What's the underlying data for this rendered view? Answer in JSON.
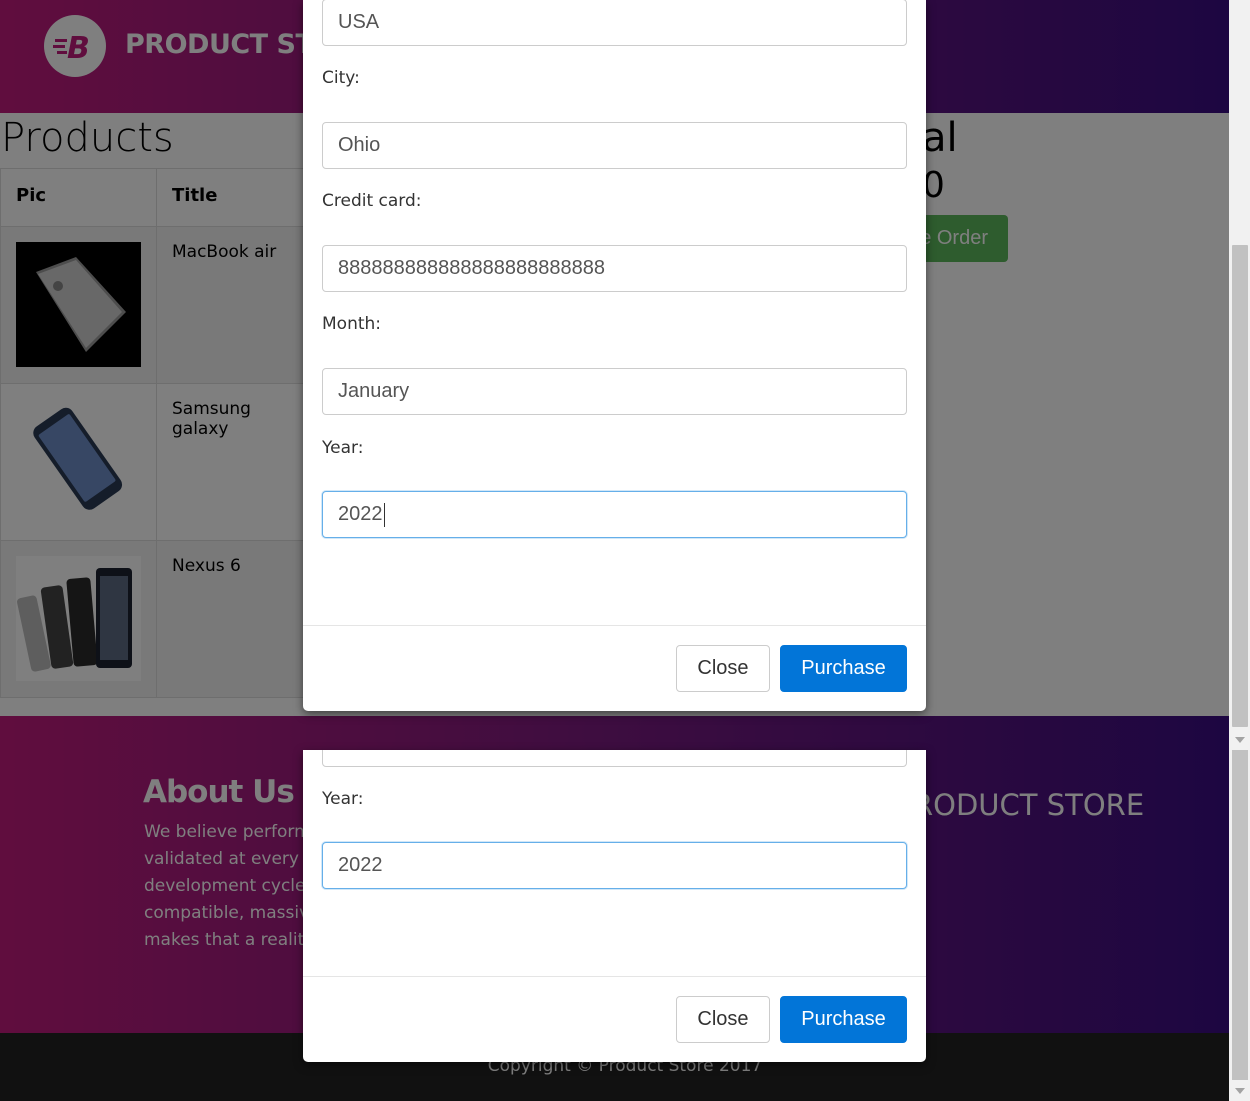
{
  "navbar": {
    "brand_text": "PRODUCT STORE",
    "brand_logo_letter": "B"
  },
  "main": {
    "products_title": "Products",
    "total_fragment": "al",
    "total_value_fragment": "0",
    "place_order_fragment": "e Order",
    "table": {
      "headers": [
        "Pic",
        "Title"
      ],
      "rows": [
        {
          "title": "MacBook air",
          "image": "macbook-image"
        },
        {
          "title": "Samsung galaxy",
          "image": "samsung-galaxy-image"
        },
        {
          "title": "Nexus 6",
          "image": "nexus-6-image"
        }
      ]
    }
  },
  "footer": {
    "about_title": "About Us",
    "about_lines": [
      "We believe perform",
      "validated at every st",
      "development cycle a",
      "compatible, massive",
      "makes that a reality."
    ],
    "brand_fragment": "RODUCT STORE",
    "copyright": "Copyright © Product Store 2017"
  },
  "modal_top": {
    "country_value": "USA",
    "city_label": "City:",
    "city_value": "Ohio",
    "card_label": "Credit card:",
    "card_value": "888888888888888888888888",
    "month_label": "Month:",
    "month_value": "January",
    "year_label": "Year:",
    "year_value": "2022",
    "close_label": "Close",
    "purchase_label": "Purchase"
  },
  "modal_bottom": {
    "year_label": "Year:",
    "year_value": "2022",
    "close_label": "Close",
    "purchase_label": "Purchase"
  },
  "colors": {
    "gradient_start": "#c11a7d",
    "gradient_end": "#3a0d82",
    "purchase_blue": "#0275d8",
    "place_order_green": "#5cb85c"
  }
}
